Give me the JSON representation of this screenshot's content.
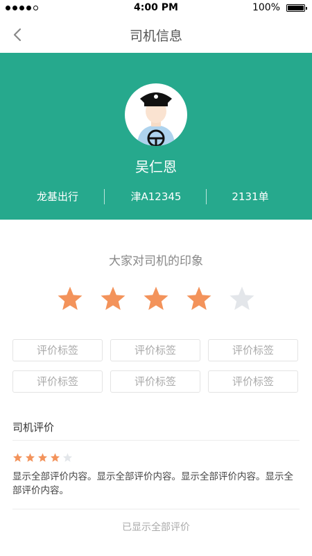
{
  "status_bar": {
    "time": "4:00 PM",
    "battery": "100%"
  },
  "nav": {
    "title": "司机信息",
    "back_icon": "chevron-left-icon"
  },
  "driver": {
    "name": "吴仁恩",
    "company": "龙基出行",
    "plate": "津A12345",
    "orders": "2131单"
  },
  "impression": {
    "title": "大家对司机的印象",
    "rating": 4,
    "max": 5,
    "tags": [
      "评价标签",
      "评价标签",
      "评价标签",
      "评价标签",
      "评价标签",
      "评价标签"
    ]
  },
  "reviews": {
    "title": "司机评价",
    "items": [
      {
        "rating": 4,
        "text": "显示全部评价内容。显示全部评价内容。显示全部评价内容。显示全部评价内容。"
      }
    ],
    "footer": "已显示全部评价"
  },
  "colors": {
    "header": "#26a98d",
    "star_on": "#f3935b",
    "star_off": "#e3e6ea"
  }
}
